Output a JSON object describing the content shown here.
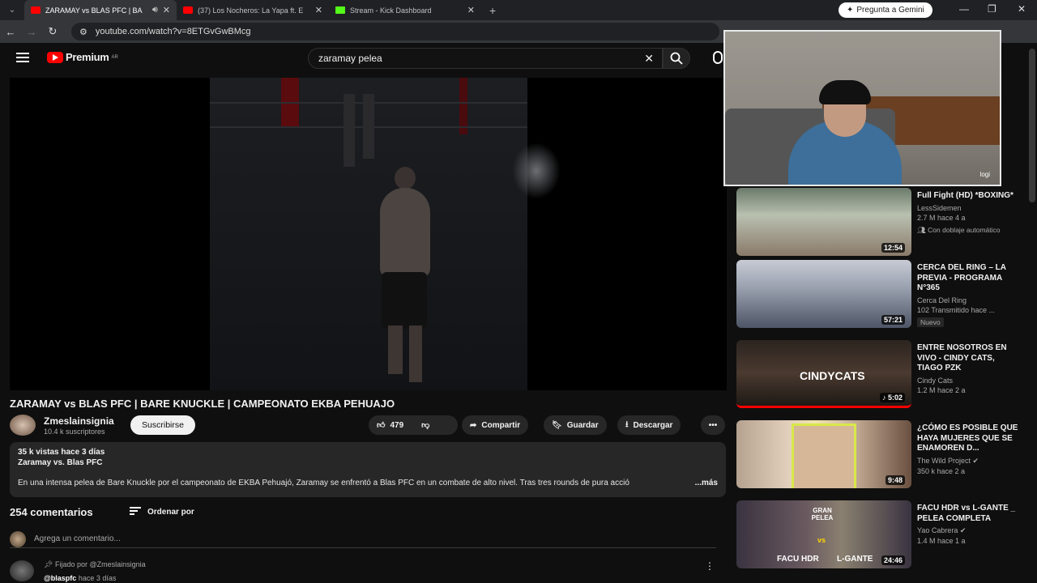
{
  "browser": {
    "tabs": [
      {
        "title": "ZARAMAY vs BLAS PFC | BA",
        "type": "youtube"
      },
      {
        "title": "(37) Los Nocheros: La Yapa ft. E",
        "type": "youtube"
      },
      {
        "title": "Stream - Kick Dashboard",
        "type": "kick"
      }
    ],
    "url": "youtube.com/watch?v=8ETGvGwBMcg",
    "gemini": "Pregunta a Gemini"
  },
  "youtube": {
    "logo": "Premium",
    "region": "AR",
    "search": "zaramay pelea"
  },
  "video": {
    "title": "ZARAMAY vs BLAS PFC | BARE KNUCKLE | CAMPEONATO EKBA PEHUAJO",
    "channel": "Zmeslainsignia",
    "subs": "10.4 k suscriptores",
    "subscribe": "Suscribirse",
    "likes": "479",
    "share": "Compartir",
    "save": "Guardar",
    "download": "Descargar"
  },
  "description": {
    "meta": "35 k vistas  hace 3 días",
    "subtitle": "Zaramay vs. Blas PFC",
    "body": "En una intensa pelea de Bare Knuckle por el campeonato de EKBA Pehuajó, Zaramay se enfrentó a Blas PFC en un combate de alto nivel. Tras tres rounds de pura acció",
    "more": "...más"
  },
  "comments": {
    "count": "254 comentarios",
    "sort": "Ordenar por",
    "add": "Agrega un comentario...",
    "pinned": "Fijado por @Zmeslainsignia",
    "author": "@blaspfc",
    "author_time": "hace 3 días"
  },
  "webcam": {
    "label": "logi"
  },
  "rail": [
    {
      "title": "Full Fight (HD) *BOXING*",
      "channel": "LessSidemen",
      "meta": "2.7 M  hace 4 a",
      "extra": "Con doblaje automático",
      "duration": "12:54"
    },
    {
      "title": "CERCA DEL RING – LA PREVIA - PROGRAMA N°365",
      "channel": "Cerca Del Ring",
      "meta": "102  Transmitido hace ...",
      "badge": "Nuevo",
      "duration": "57:21"
    },
    {
      "title": "ENTRE NOSOTROS EN VIVO - CINDY CATS, TIAGO PZK",
      "channel": "Cindy Cats",
      "meta": "1.2 M  hace 2 a",
      "duration": "5:02",
      "thumb_text": "CINDYCATS"
    },
    {
      "title": "¿CÓMO ES POSIBLE QUE HAYA MUJERES QUE SE ENAMOREN D...",
      "channel": "The Wild Project",
      "meta": "350 k  hace 2 a",
      "duration": "9:48"
    },
    {
      "title": "FACU HDR vs L-GANTE _ PELEA COMPLETA",
      "channel": "Yao Cabrera",
      "meta": "1.4 M  hace 1 a",
      "duration": "24:46",
      "thumb_left": "FACU HDR",
      "thumb_right": "L-GANTE",
      "thumb_vs": "vs",
      "thumb_badge": "GRAN PELEA"
    }
  ]
}
